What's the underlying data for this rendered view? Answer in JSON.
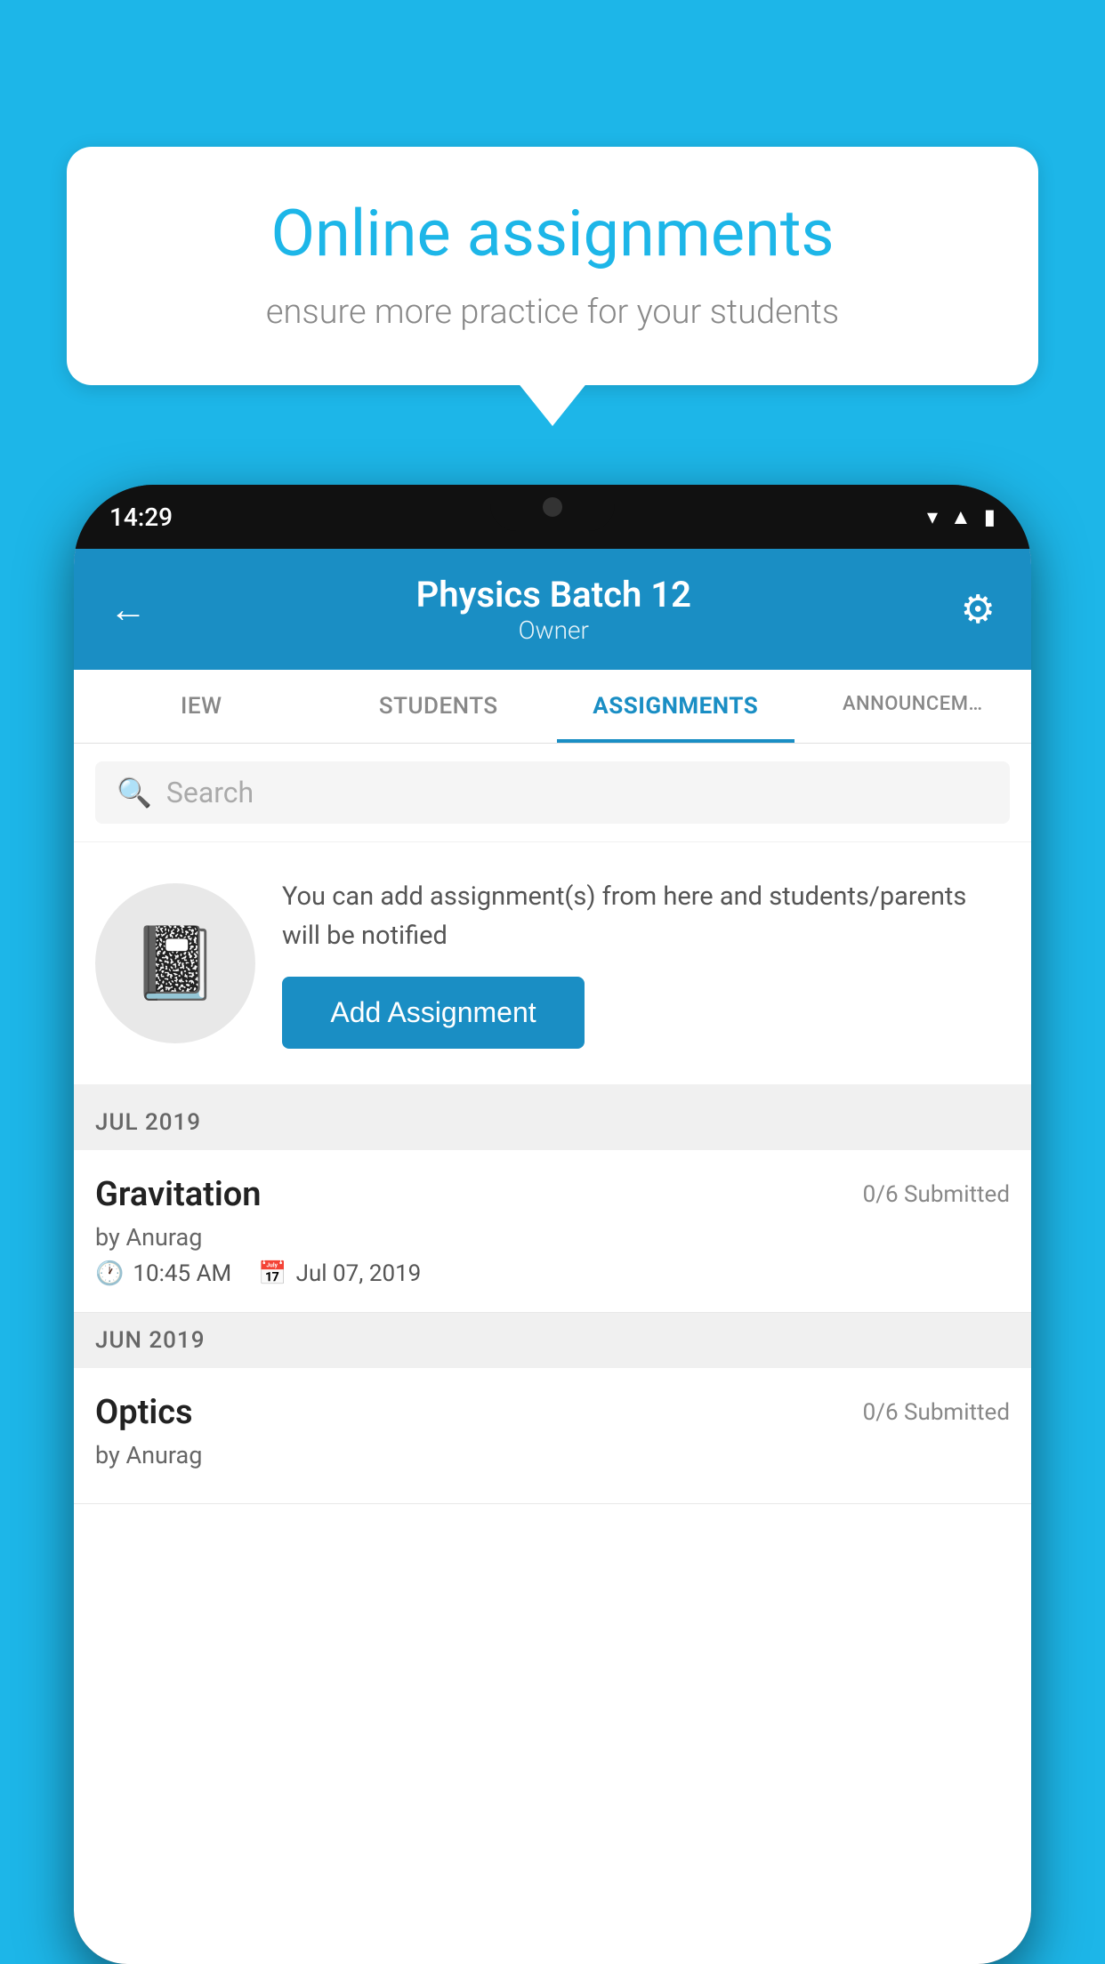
{
  "background": {
    "color": "#1db6e8"
  },
  "speech_bubble": {
    "title": "Online assignments",
    "subtitle": "ensure more practice for your students"
  },
  "phone": {
    "status_bar": {
      "time": "14:29",
      "icons": [
        "wifi",
        "signal",
        "battery"
      ]
    },
    "header": {
      "title": "Physics Batch 12",
      "subtitle": "Owner",
      "back_label": "←",
      "gear_label": "⚙"
    },
    "tabs": [
      {
        "label": "IEW",
        "active": false
      },
      {
        "label": "STUDENTS",
        "active": false
      },
      {
        "label": "ASSIGNMENTS",
        "active": true
      },
      {
        "label": "ANNOUNCEM…",
        "active": false
      }
    ],
    "search": {
      "placeholder": "Search",
      "icon": "🔍"
    },
    "empty_state": {
      "icon": "📓",
      "description": "You can add assignment(s) from here and students/parents will be notified",
      "button_label": "Add Assignment"
    },
    "sections": [
      {
        "label": "JUL 2019",
        "assignments": [
          {
            "name": "Gravitation",
            "submitted": "0/6 Submitted",
            "by": "by Anurag",
            "time": "10:45 AM",
            "date": "Jul 07, 2019"
          }
        ]
      },
      {
        "label": "JUN 2019",
        "assignments": [
          {
            "name": "Optics",
            "submitted": "0/6 Submitted",
            "by": "by Anurag",
            "time": "",
            "date": ""
          }
        ]
      }
    ]
  }
}
